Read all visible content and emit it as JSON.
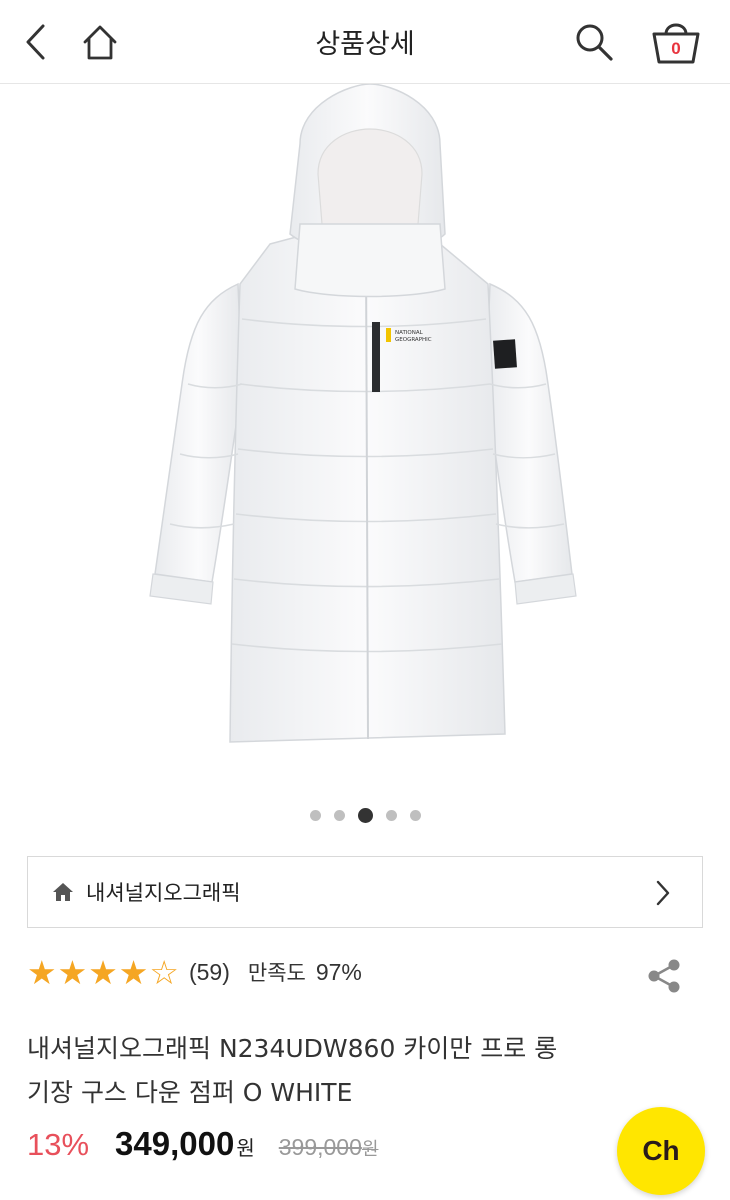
{
  "header": {
    "title": "상품상세",
    "cart_count": "0",
    "icons": [
      "back-arrow-icon",
      "home-icon",
      "search-icon",
      "shopping-basket-icon"
    ]
  },
  "carousel": {
    "total": 5,
    "active_index": 2
  },
  "brand": {
    "name": "내셔널지오그래픽",
    "icons": [
      "home-icon",
      "chevron-right-icon"
    ]
  },
  "rating": {
    "stars_filled": 4,
    "stars_total": 5,
    "review_count": "(59)",
    "satisfaction_label": "만족도",
    "satisfaction_value": "97%"
  },
  "product": {
    "title_line1": "내셔널지오그래픽 N234UDW860 카이만 프로 롱",
    "title_line2": "기장 구스 다운 점퍼 O WHITE"
  },
  "price": {
    "discount": "13%",
    "sale": "349,000",
    "won": "원",
    "original": "399,000",
    "original_won": "원"
  },
  "chat_button": {
    "label": "Ch"
  },
  "colors": {
    "accent_red": "#e8505b",
    "star": "#f5a623",
    "chat_yellow": "#ffe600"
  }
}
